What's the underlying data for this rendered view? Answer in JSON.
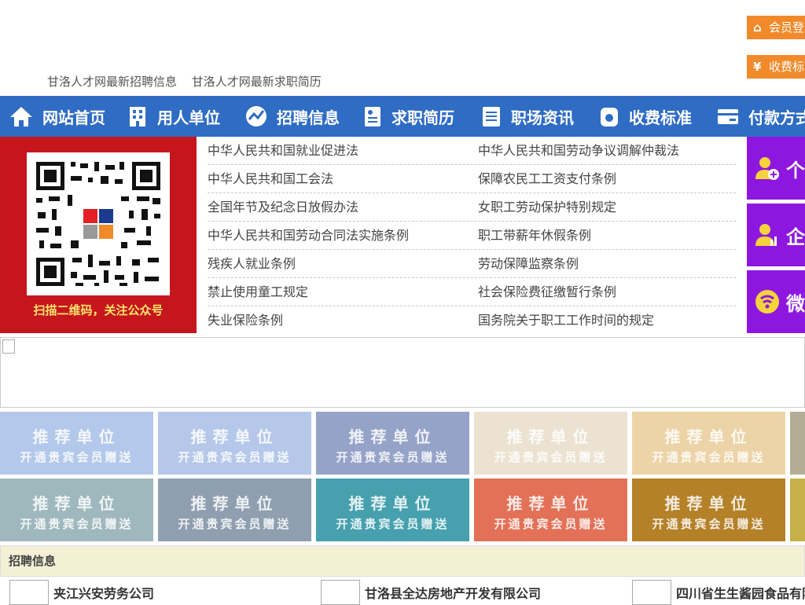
{
  "header": {
    "member_login": "会员登录",
    "fees": "收费标准",
    "links": [
      "甘洛人才网最新招聘信息",
      "甘洛人才网最新求职简历"
    ]
  },
  "nav": [
    "网站首页",
    "用人单位",
    "招聘信息",
    "求职简历",
    "职场资讯",
    "收费标准",
    "付款方式"
  ],
  "qr": {
    "caption": "扫描二维码，关注公众号"
  },
  "laws": [
    [
      "中华人民共和国就业促进法",
      "中华人民共和国劳动争议调解仲裁法"
    ],
    [
      "中华人民共和国工会法",
      "保障农民工工资支付条例"
    ],
    [
      "全国年节及纪念日放假办法",
      "女职工劳动保护特别规定"
    ],
    [
      "中华人民共和国劳动合同法实施条例",
      "职工带薪年休假条例"
    ],
    [
      "残疾人就业条例",
      "劳动保障监察条例"
    ],
    [
      "禁止使用童工规定",
      "社会保险费征缴暂行条例"
    ],
    [
      "失业保险条例",
      "国务院关于职工工作时间的规定"
    ]
  ],
  "side": [
    "个",
    "企",
    "微"
  ],
  "tiles": {
    "title": "推荐单位",
    "subtitle": "开通贵宾会员赠送",
    "row1_colors": [
      "#b3c8ea",
      "#b5c8ea",
      "#96a3c8",
      "#ece2d2",
      "#ecd4a8",
      "#b3ad95"
    ],
    "row2_colors": [
      "#9fb8be",
      "#8f9fb0",
      "#46a0ae",
      "#e37157",
      "#b48128",
      "#c5b04a"
    ]
  },
  "section": {
    "title": "招聘信息"
  },
  "companies": [
    "夹江兴安劳务公司",
    "甘洛县全达房地产开发有限公司",
    "四川省生生酱园食品有限公司"
  ],
  "colors": {
    "nav": "#2f6cc4",
    "accent": "#f08a2a",
    "side": "#8e17e0",
    "qr_bg": "#c5161d"
  }
}
